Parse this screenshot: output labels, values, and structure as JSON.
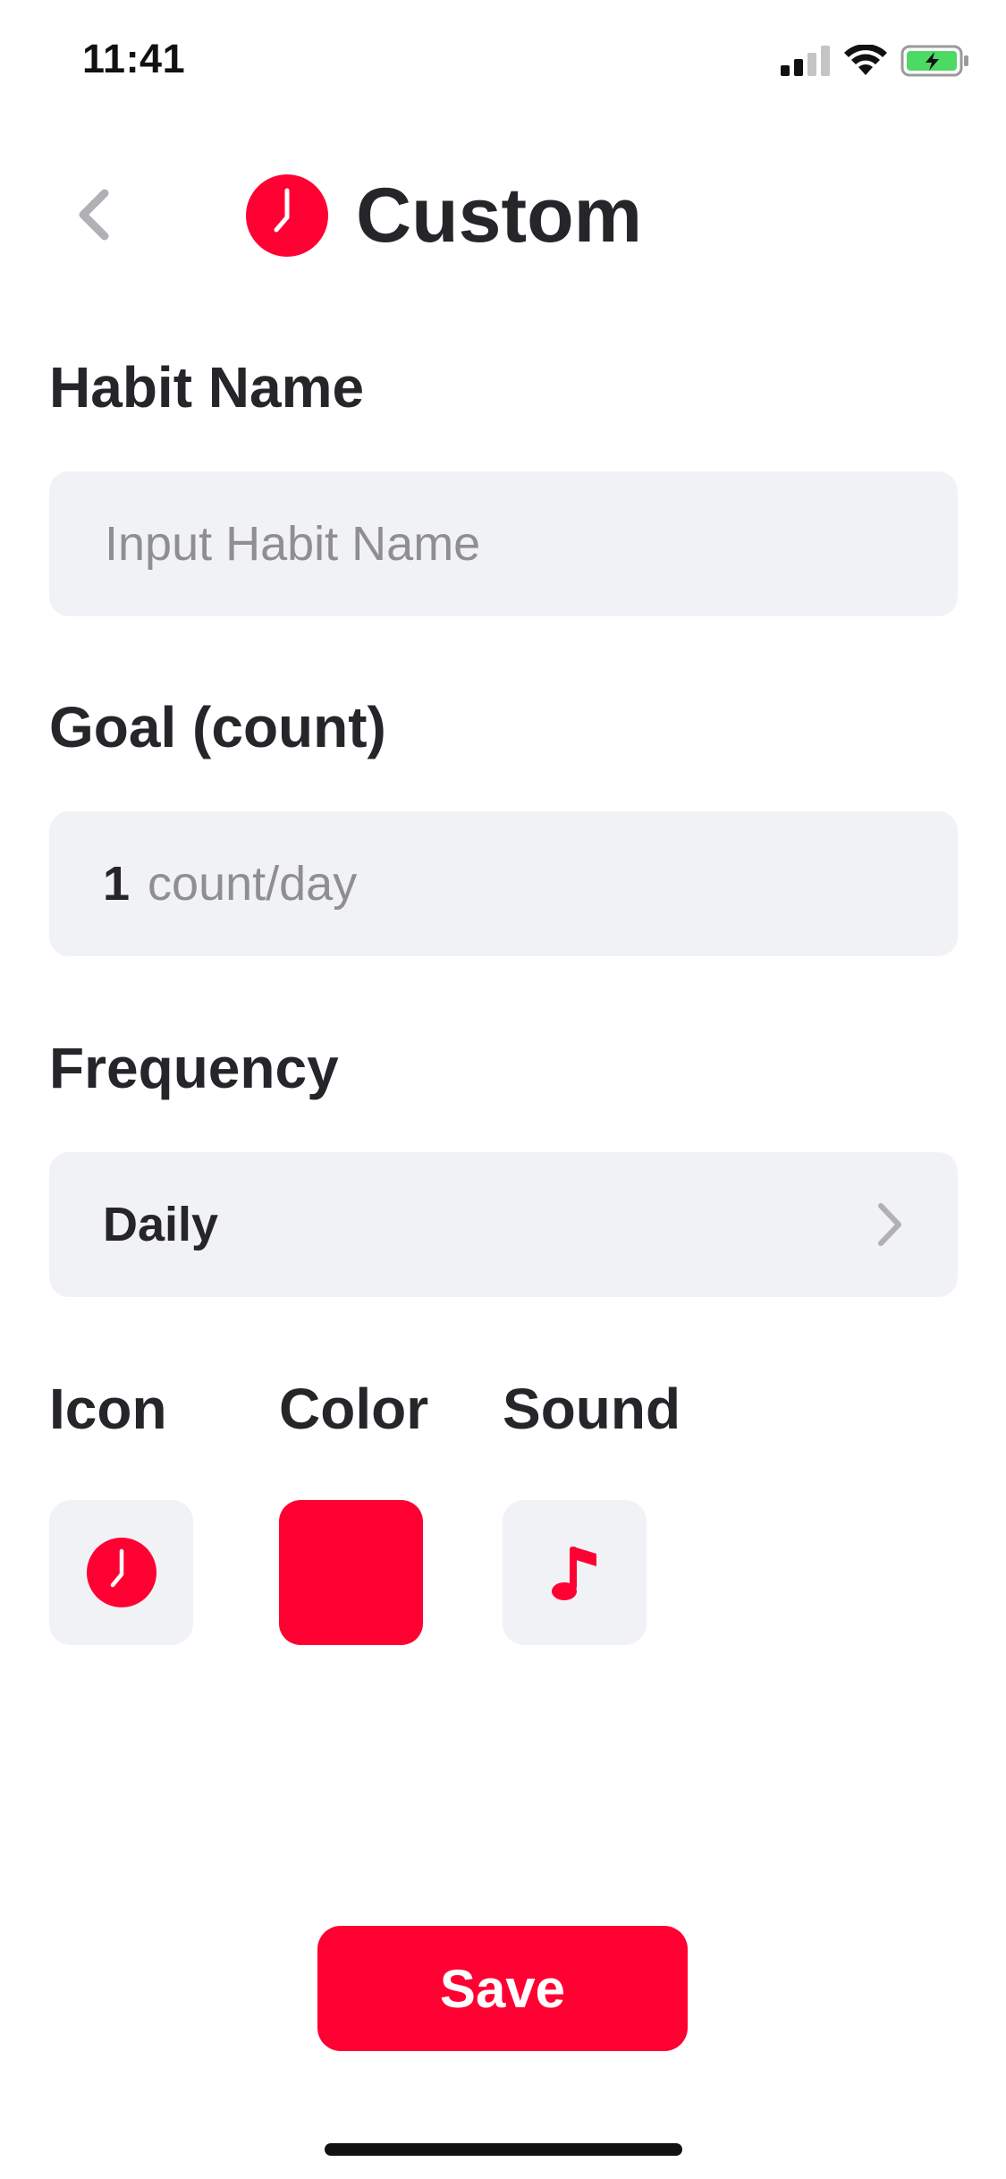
{
  "status_bar": {
    "time": "11:41",
    "icons": [
      "cellular-signal-icon",
      "wifi-icon",
      "battery-charging-icon"
    ]
  },
  "header": {
    "back_icon": "chevron-left-icon",
    "icon": "clock-icon",
    "title": "Custom"
  },
  "habit_name": {
    "label": "Habit Name",
    "value": "",
    "placeholder": "Input Habit Name"
  },
  "goal": {
    "label": "Goal (count)",
    "value": "1",
    "unit": "count/day"
  },
  "frequency": {
    "label": "Frequency",
    "value": "Daily",
    "chevron_icon": "chevron-right-icon"
  },
  "options": {
    "icon_label": "Icon",
    "color_label": "Color",
    "sound_label": "Sound",
    "selected_icon": "clock-icon",
    "selected_sound_icon": "music-note-icon"
  },
  "save_label": "Save",
  "colors": {
    "accent": "#ff0033",
    "field_background": "#f1f2f6",
    "text": "#26262a",
    "placeholder": "#8e8e93"
  }
}
